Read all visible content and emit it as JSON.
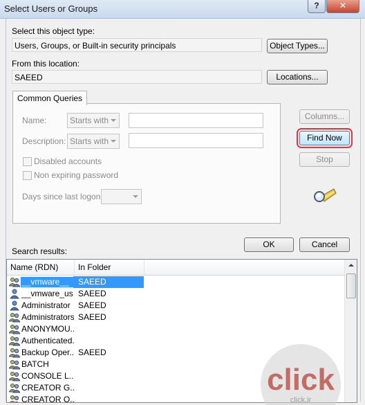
{
  "window": {
    "title": "Select Users or Groups",
    "help_glyph": "?",
    "close_glyph": "✕"
  },
  "object_type": {
    "label": "Select this object type:",
    "value": "Users, Groups, or Built-in security principals",
    "button": "Object Types..."
  },
  "location": {
    "label": "From this location:",
    "value": "SAEED",
    "button": "Locations..."
  },
  "queries": {
    "tab_label": "Common Queries",
    "name_label": "Name:",
    "name_mode": "Starts with",
    "description_label": "Description:",
    "description_mode": "Starts with",
    "disabled_accounts": "Disabled accounts",
    "non_expiring_password": "Non expiring password",
    "days_label": "Days since last logon:"
  },
  "side_buttons": {
    "columns": "Columns...",
    "find_now": "Find Now",
    "stop": "Stop"
  },
  "actions": {
    "ok": "OK",
    "cancel": "Cancel"
  },
  "results": {
    "label": "Search results:",
    "columns": [
      "Name (RDN)",
      "In Folder"
    ],
    "rows": [
      {
        "name": "__vmware__",
        "folder": "SAEED",
        "icon": "group-icon"
      },
      {
        "name": "__vmware_us...",
        "folder": "SAEED",
        "icon": "user-icon"
      },
      {
        "name": "Administrator",
        "folder": "SAEED",
        "icon": "user-icon"
      },
      {
        "name": "Administrators",
        "folder": "SAEED",
        "icon": "group-icon"
      },
      {
        "name": "ANONYMOU...",
        "folder": "",
        "icon": "group-icon"
      },
      {
        "name": "Authenticated...",
        "folder": "",
        "icon": "group-icon"
      },
      {
        "name": "Backup Oper...",
        "folder": "SAEED",
        "icon": "group-icon"
      },
      {
        "name": "BATCH",
        "folder": "",
        "icon": "group-icon"
      },
      {
        "name": "CONSOLE L...",
        "folder": "",
        "icon": "group-icon"
      },
      {
        "name": "CREATOR G...",
        "folder": "",
        "icon": "group-icon"
      },
      {
        "name": "CREATOR O...",
        "folder": "",
        "icon": "group-icon"
      }
    ],
    "selected_index": 0
  },
  "watermark": {
    "text": "click",
    "subtext": "click.ir"
  },
  "colors": {
    "selection": "#3399ff",
    "focus_outline": "#d23a4a"
  }
}
